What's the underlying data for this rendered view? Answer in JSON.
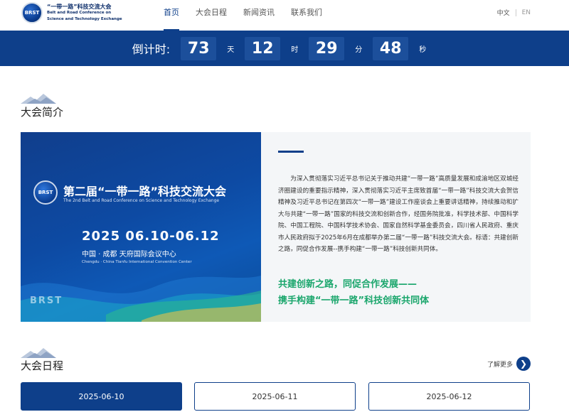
{
  "header": {
    "logo_mark": "BRST",
    "logo_cn": "“一带一路”科技交流大会",
    "logo_en_line1": "Belt and Road Conference on",
    "logo_en_line2": "Science and Technology Exchange",
    "nav": [
      {
        "label": "首页",
        "active": true
      },
      {
        "label": "大会日程",
        "active": false
      },
      {
        "label": "新闻资讯",
        "active": false
      },
      {
        "label": "联系我们",
        "active": false
      }
    ],
    "lang_cn": "中文",
    "lang_en": "EN"
  },
  "countdown": {
    "label": "倒计时:",
    "days": "73",
    "days_unit": "天",
    "hours": "12",
    "hours_unit": "时",
    "minutes": "29",
    "minutes_unit": "分",
    "seconds": "48",
    "seconds_unit": "秒"
  },
  "intro": {
    "section_title": "大会简介",
    "banner": {
      "logo": "BRST",
      "title": "第二届“一带一路”科技交流大会",
      "subtitle": "The 2nd Belt and Road Conference on Science and Technology Exchange",
      "date": "2025 06.10-06.12",
      "place": "中国 · 成都    天府国际会议中心",
      "place_en": "Chengdu · China Tianfu International Convention Center",
      "brand": "BRST"
    },
    "paragraph": "为深入贯彻落实习近平总书记关于推动共建“一带一路”高质量发展和成渝地区双城经济圈建设的重要指示精神，深入贯彻落实习近平主席致首届“一带一路”科技交流大会贺信精神及习近平总书记在第四次“一带一路”建设工作座谈会上重要讲话精神，持续推动和扩大与共建“一带一路”国家的科技交流和创新合作，经国务院批准，科学技术部、中国科学院、中国工程院、中国科学技术协会、国家自然科学基金委员会，四川省人民政府、重庆市人民政府拟于2025年6月在成都举办第二届“一带一路”科技交流大会。标语：共建创新之路，同促合作发展--携手构建“一带一路”科技创新共同体。",
    "slogan1": "共建创新之路，同促合作发展——",
    "slogan2": "携手构建“一带一路”科技创新共同体",
    "accent_color": "#1aa66c"
  },
  "schedule": {
    "section_title": "大会日程",
    "more_label": "了解更多",
    "dates": [
      {
        "label": "2025-06-10",
        "active": true
      },
      {
        "label": "2025-06-11",
        "active": false
      },
      {
        "label": "2025-06-12",
        "active": false
      }
    ]
  },
  "colors": {
    "primary": "#0e3f8a",
    "countdown_box": "#1c4f9b"
  },
  "icons": [
    "mountain-decoration-icon",
    "arrow-right-icon"
  ]
}
